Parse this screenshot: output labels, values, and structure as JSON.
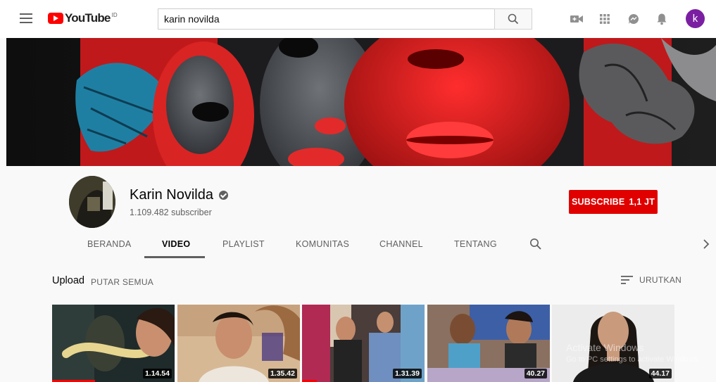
{
  "masthead": {
    "logo_text": "YouTube",
    "logo_region": "ID",
    "search_query": "karin novilda"
  },
  "icons": {
    "menu": "hamburger-menu-icon",
    "search": "search-icon",
    "create": "video-camera-icon",
    "apps": "apps-grid-icon",
    "messages": "messages-icon",
    "notifications": "bell-icon",
    "user_initial": "k"
  },
  "channel": {
    "name": "Karin Novilda",
    "subscribers": "1.109.482 subscriber",
    "subscribe_label": "SUBSCRIBE",
    "subscribe_count": "1,1 JT"
  },
  "tabs": [
    {
      "label": "BERANDA",
      "active": false
    },
    {
      "label": "VIDEO",
      "active": true
    },
    {
      "label": "PLAYLIST",
      "active": false
    },
    {
      "label": "KOMUNITAS",
      "active": false
    },
    {
      "label": "CHANNEL",
      "active": false
    },
    {
      "label": "TENTANG",
      "active": false
    }
  ],
  "section": {
    "title": "Upload",
    "play_all": "PUTAR SEMUA",
    "sort_label": "URUTKAN"
  },
  "videos": [
    {
      "duration": "1.14.54",
      "watched": 0.35
    },
    {
      "duration": "1.35.42",
      "watched": 0
    },
    {
      "duration": "1.31.39",
      "watched": 0.12
    },
    {
      "duration": "40.27",
      "watched": 0
    },
    {
      "duration": "44.17",
      "watched": 0
    }
  ],
  "watermark": {
    "line1": "Activate Windows",
    "line2": "Go to PC settings to activate Windows."
  },
  "colors": {
    "brand_red": "#ff0000",
    "subscribe_red": "#e00000",
    "user_avatar": "#7b1fa2"
  }
}
